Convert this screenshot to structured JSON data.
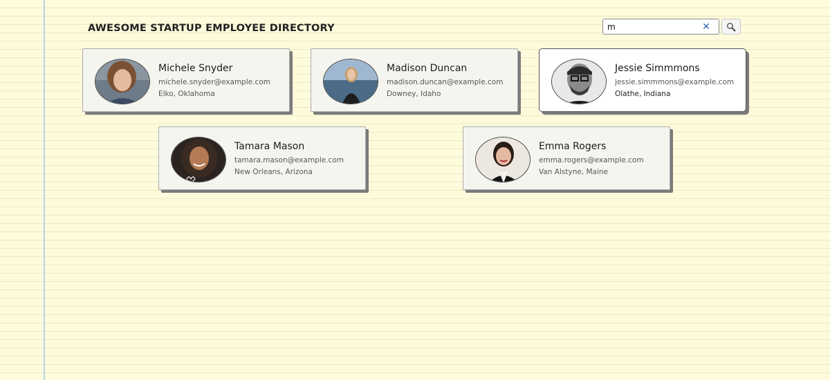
{
  "header": {
    "title": "Awesome Startup Employee Directory"
  },
  "search": {
    "value": "m",
    "placeholder": ""
  },
  "colors": {
    "background": "#fdfbdc",
    "margin_line": "#b9d3e0",
    "clear_icon": "#2d67b5",
    "card_shadow": "#7b7b7b"
  },
  "employees": [
    {
      "name": "Michele Snyder",
      "email": "michele.snyder@example.com",
      "location": "Elko, Oklahoma",
      "avatar_icon": "person-photo",
      "selected": false
    },
    {
      "name": "Madison Duncan",
      "email": "madison.duncan@example.com",
      "location": "Downey, Idaho",
      "avatar_icon": "person-photo",
      "selected": false
    },
    {
      "name": "Jessie Simmmons",
      "email": "jessie.simmmons@example.com",
      "location": "Olathe, Indiana",
      "avatar_icon": "person-photo",
      "selected": true
    },
    {
      "name": "Tamara Mason",
      "email": "tamara.mason@example.com",
      "location": "New Orleans, Arizona",
      "avatar_icon": "person-photo",
      "selected": false
    },
    {
      "name": "Emma Rogers",
      "email": "emma.rogers@example.com",
      "location": "Van Alstyne, Maine",
      "avatar_icon": "person-photo",
      "selected": false
    }
  ]
}
